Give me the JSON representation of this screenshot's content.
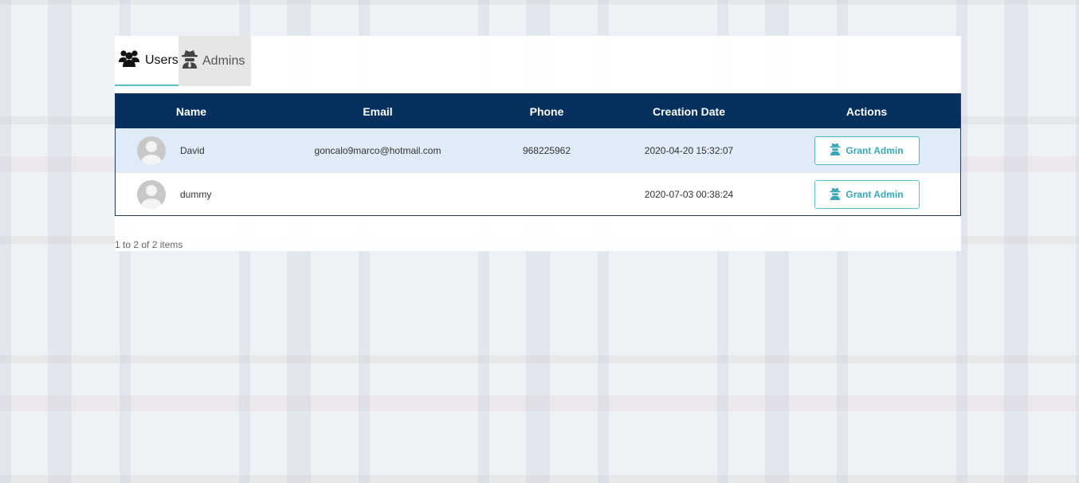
{
  "tabs": [
    {
      "label": "Users",
      "icon": "users-icon",
      "active": true
    },
    {
      "label": "Admins",
      "icon": "spy-icon",
      "active": false
    }
  ],
  "table": {
    "columns": [
      "Name",
      "Email",
      "Phone",
      "Creation Date",
      "Actions"
    ],
    "rows": [
      {
        "name": "David",
        "email": "goncalo9marco@hotmail.com",
        "phone": "968225962",
        "created": "2020-04-20 15:32:07",
        "action": "Grant Admin"
      },
      {
        "name": "dummy",
        "email": "",
        "phone": "",
        "created": "2020-07-03 00:38:24",
        "action": "Grant Admin"
      }
    ]
  },
  "pager": {
    "summary": "1 to 2 of 2 items"
  },
  "colors": {
    "header_bg": "#04305e",
    "accent": "#5bbcc8",
    "row_highlight": "#e0ebf8"
  }
}
